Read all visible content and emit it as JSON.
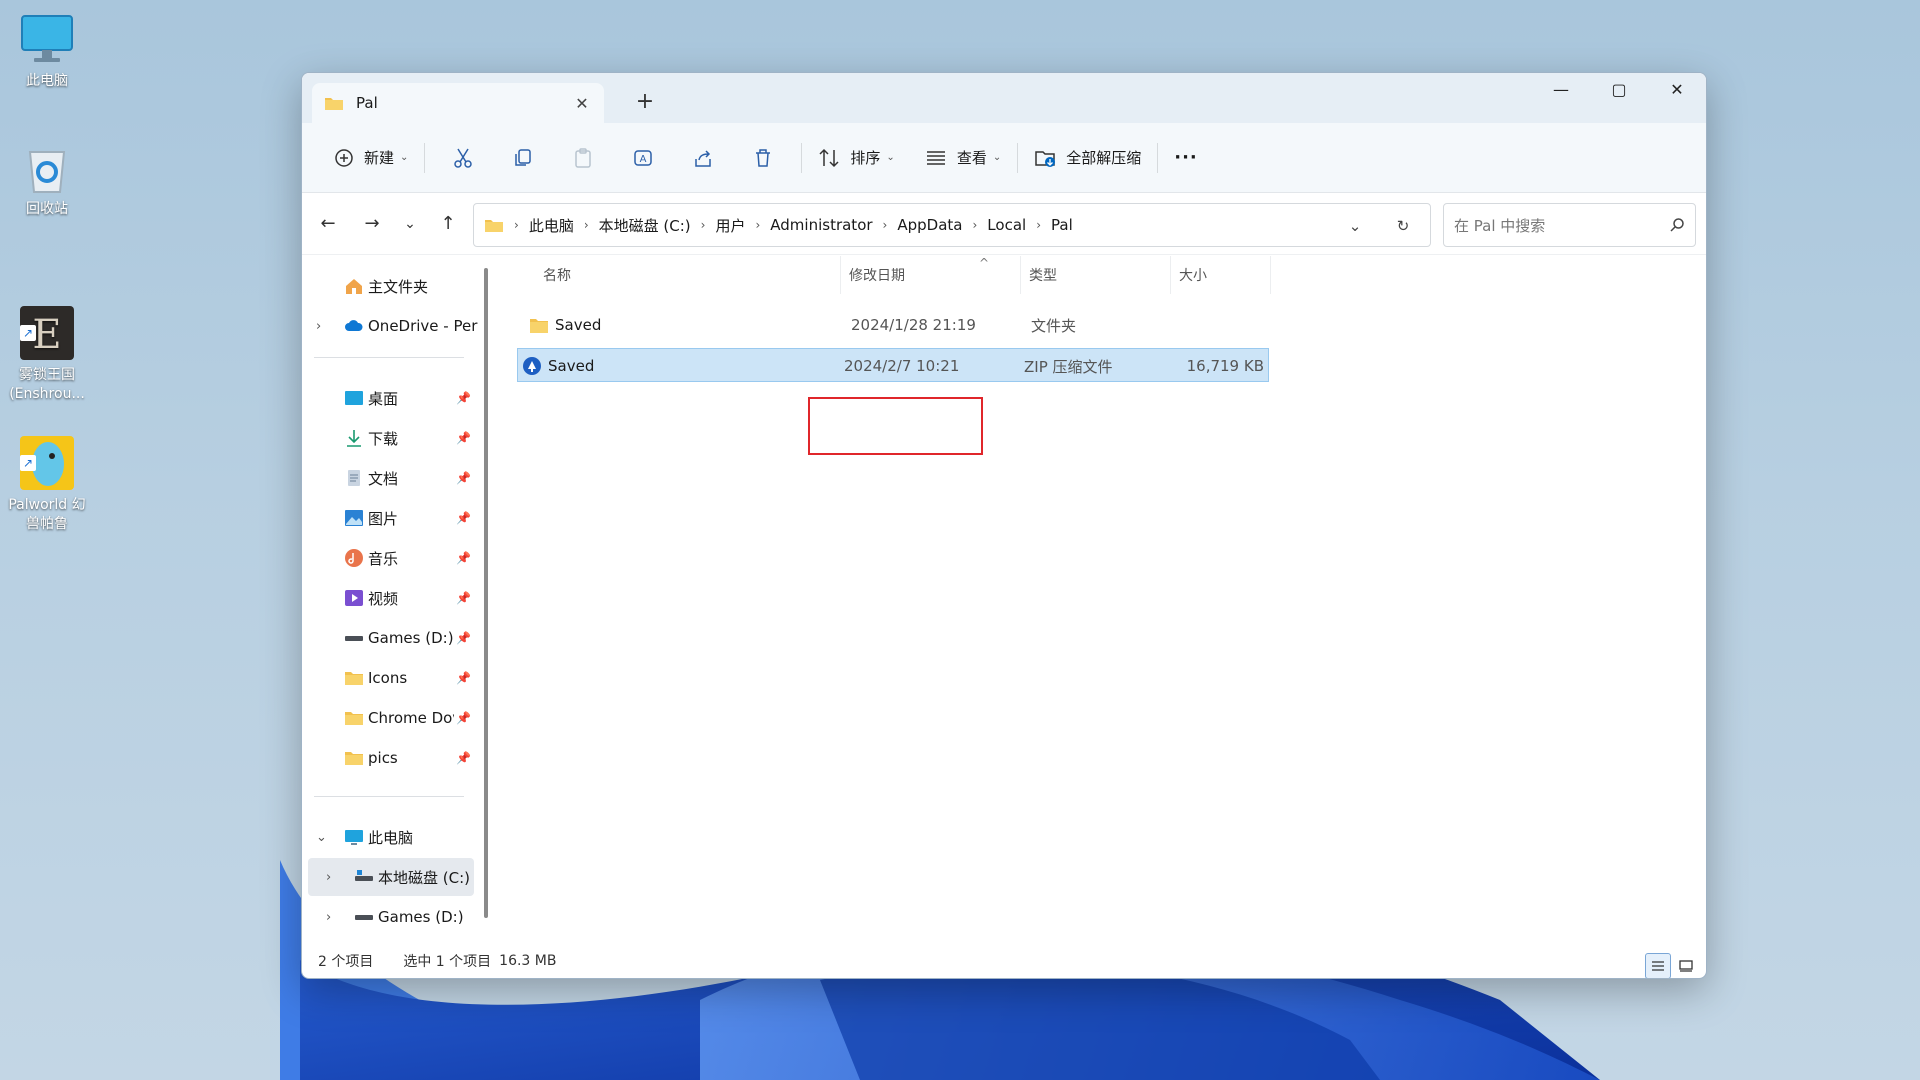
{
  "desktop": {
    "icons": [
      {
        "label": "此电脑"
      },
      {
        "label": "回收站"
      },
      {
        "label": "雾锁王国\n(Enshrou..."
      },
      {
        "label": "Palworld 幻\n兽帕鲁"
      }
    ]
  },
  "window": {
    "tab_title": "Pal",
    "controls": {
      "minimize": "—",
      "maximize": "▢",
      "close": "✕"
    }
  },
  "toolbar": {
    "new_label": "新建",
    "sort_label": "排序",
    "view_label": "查看",
    "extract_label": "全部解压缩",
    "more_label": "···"
  },
  "address": {
    "crumbs": [
      "此电脑",
      "本地磁盘 (C:)",
      "用户",
      "Administrator",
      "AppData",
      "Local",
      "Pal"
    ]
  },
  "search": {
    "placeholder": "在 Pal 中搜索"
  },
  "sidebar": {
    "items": [
      {
        "label": "主文件夹"
      },
      {
        "label": "OneDrive - Per"
      },
      {
        "label": "桌面"
      },
      {
        "label": "下载"
      },
      {
        "label": "文档"
      },
      {
        "label": "图片"
      },
      {
        "label": "音乐"
      },
      {
        "label": "视频"
      },
      {
        "label": "Games (D:)"
      },
      {
        "label": "Icons"
      },
      {
        "label": "Chrome Dov"
      },
      {
        "label": "pics"
      },
      {
        "label": "此电脑"
      },
      {
        "label": "本地磁盘 (C:)"
      },
      {
        "label": "Games (D:)"
      }
    ]
  },
  "columns": {
    "name": "名称",
    "date": "修改日期",
    "type": "类型",
    "size": "大小"
  },
  "files": [
    {
      "name": "Saved",
      "date": "2024/1/28 21:19",
      "type": "文件夹",
      "size": ""
    },
    {
      "name": "Saved",
      "date": "2024/2/7 10:21",
      "type": "ZIP 压缩文件",
      "size": "16,719 KB"
    }
  ],
  "status": {
    "count": "2 个项目",
    "selection": "选中 1 个项目",
    "selection_size": "16.3 MB"
  },
  "colors": {
    "accent": "#0067c0",
    "selection": "#cce4f7",
    "highlight": "#e0262b",
    "folder": "#f2c14e"
  }
}
